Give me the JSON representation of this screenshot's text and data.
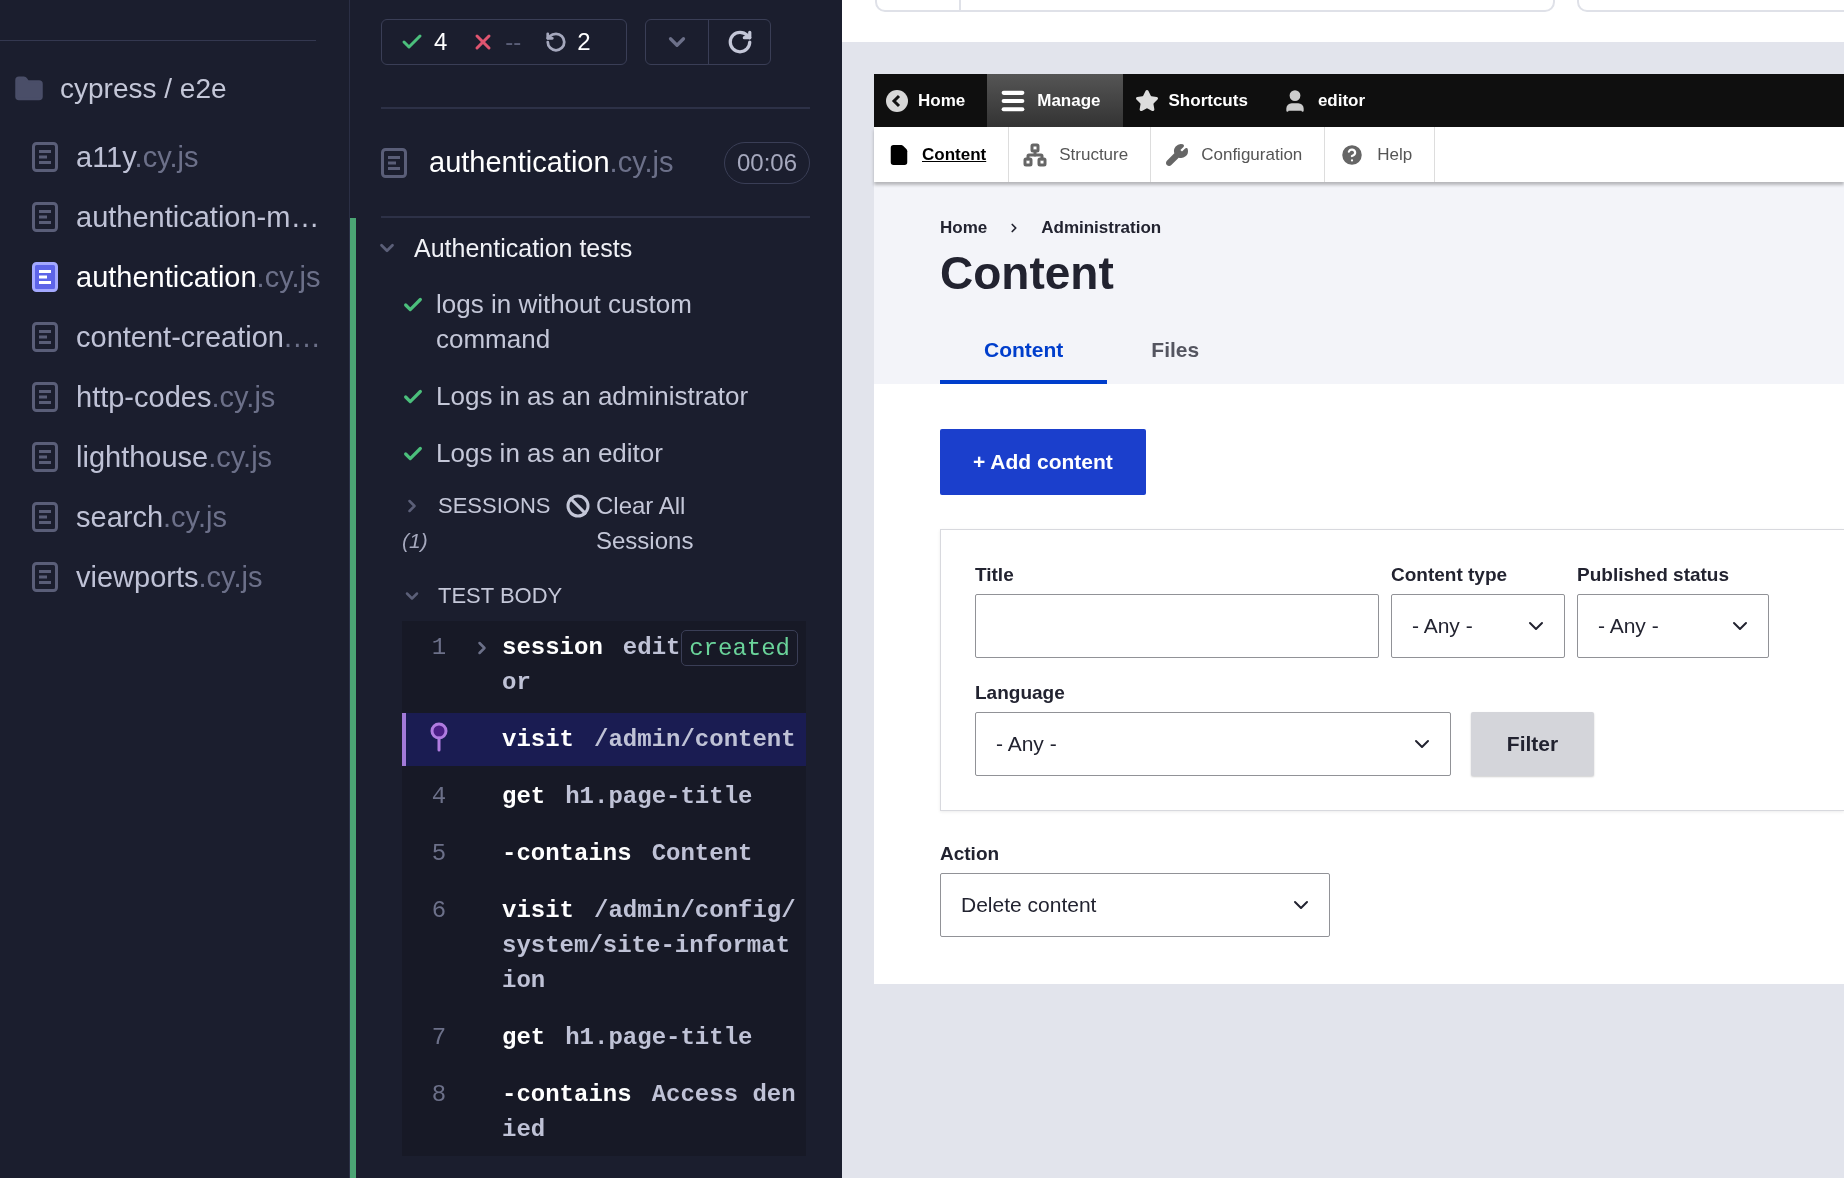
{
  "sidebar": {
    "folder": "cypress / e2e",
    "files": [
      {
        "name": "a11y",
        "ext": ".cy.js",
        "selected": false
      },
      {
        "name": "authentication-m…",
        "selected": false
      },
      {
        "name": "authentication",
        "ext": ".cy.js",
        "selected": true
      },
      {
        "name": "content-creation",
        "ext": ".…",
        "selected": false
      },
      {
        "name": "http-codes",
        "ext": ".cy.js",
        "selected": false
      },
      {
        "name": "lighthouse",
        "ext": ".cy.js",
        "selected": false
      },
      {
        "name": "search",
        "ext": ".cy.js",
        "selected": false
      },
      {
        "name": "viewports",
        "ext": ".cy.js",
        "selected": false
      }
    ]
  },
  "reporter": {
    "stats": {
      "passed": "4",
      "failed": "--",
      "pending": "2"
    },
    "spec": {
      "name": "authentication",
      "ext": ".cy.js",
      "duration": "00:06"
    },
    "suite": {
      "title": "Authentication tests",
      "expanded": true
    },
    "tests": [
      {
        "title": "logs in without custom command",
        "passed": true
      },
      {
        "title": "Logs in as an administrator",
        "passed": true
      },
      {
        "title": "Logs in as an editor",
        "passed": true
      }
    ],
    "sessions": {
      "label": "SESSIONS",
      "count": "(1)",
      "expanded": false,
      "clear": "Clear All Sessions"
    },
    "test_body": {
      "label": "TEST BODY",
      "expanded": true
    },
    "commands": [
      {
        "kind": "step",
        "number": "1",
        "name": "session",
        "message": "editor",
        "badge": "created",
        "expandable": true,
        "selected": false
      },
      {
        "kind": "pinned",
        "name": "visit",
        "message": "/admin/content",
        "selected": true
      },
      {
        "kind": "step",
        "number": "4",
        "name": "get",
        "message": "h1.page-title",
        "selected": false
      },
      {
        "kind": "step",
        "number": "5",
        "name": "-contains",
        "message": "Content",
        "selected": false
      },
      {
        "kind": "step",
        "number": "6",
        "name": "visit",
        "message": "/admin/config/system/site-information",
        "selected": false
      },
      {
        "kind": "step",
        "number": "7",
        "name": "get",
        "message": "h1.page-title",
        "selected": false
      },
      {
        "kind": "step",
        "number": "8",
        "name": "-contains",
        "message": "Access denied",
        "selected": false
      }
    ]
  },
  "drupal": {
    "toolbar": [
      {
        "label": "Home",
        "selected": false
      },
      {
        "label": "Manage",
        "selected": true
      },
      {
        "label": "Shortcuts",
        "selected": false
      },
      {
        "label": "editor",
        "selected": false
      }
    ],
    "menu": [
      {
        "label": "Content",
        "selected": true
      },
      {
        "label": "Structure",
        "selected": false
      },
      {
        "label": "Configuration",
        "selected": false
      },
      {
        "label": "Help",
        "selected": false
      }
    ],
    "breadcrumb": [
      "Home",
      "Administration"
    ],
    "title": "Content",
    "tabs": [
      {
        "label": "Content",
        "selected": true
      },
      {
        "label": "Files",
        "selected": false
      }
    ],
    "add_button": "+ Add content",
    "filters": {
      "title_label": "Title",
      "type_label": "Content type",
      "type_value": "- Any -",
      "status_label": "Published status",
      "status_value": "- Any -",
      "language_label": "Language",
      "language_value": "- Any -",
      "button": "Filter"
    },
    "action": {
      "label": "Action",
      "value": "Delete content"
    }
  }
}
